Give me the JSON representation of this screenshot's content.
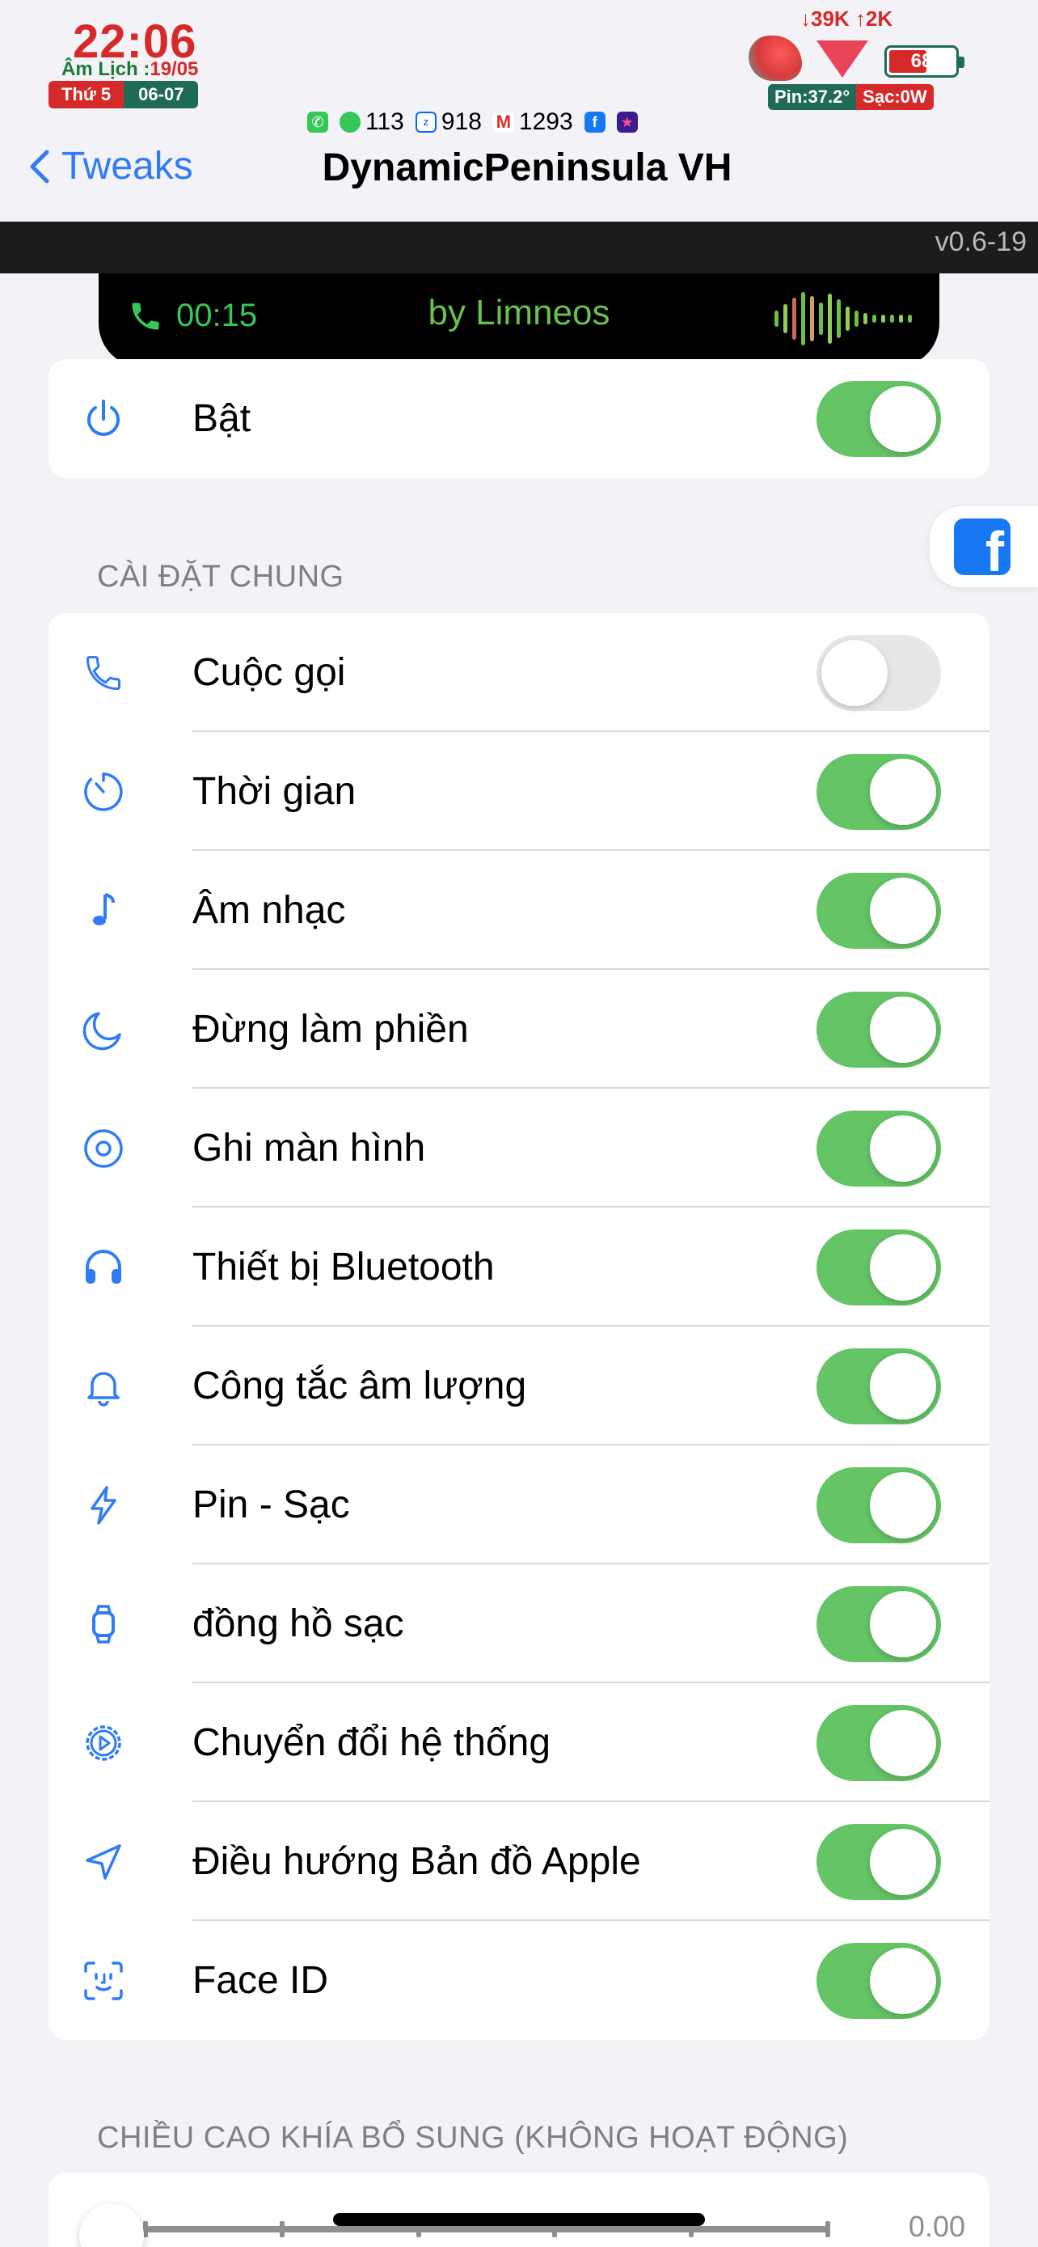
{
  "status_bar": {
    "time": "22:06",
    "lunar_prefix": "Âm Lịch :",
    "lunar_date": "19/05",
    "weekday": "Thứ 5",
    "date": "06-07",
    "net_speed": "↓39K ↑2K",
    "battery_level": "68",
    "battery_fraction": 0.62,
    "pin_temp": "Pin:37.2°",
    "charging": "Sạc:0W"
  },
  "notifications": [
    {
      "icon": "phone-icon",
      "count": ""
    },
    {
      "icon": "messages-icon",
      "count": "113"
    },
    {
      "icon": "zalo-icon",
      "count": "918"
    },
    {
      "icon": "gmail-icon",
      "count": "1293"
    },
    {
      "icon": "facebook-icon",
      "count": ""
    },
    {
      "icon": "app-icon",
      "count": ""
    }
  ],
  "nav": {
    "back_label": "Tweaks",
    "title": "DynamicPeninsula VH"
  },
  "preview": {
    "version": "v0.6-19",
    "call_time": "00:15",
    "byline": "by Limneos"
  },
  "enable_group": {
    "label": "Bật",
    "enabled": true,
    "icon": "power-icon"
  },
  "general_section": {
    "header": "CÀI ĐẶT CHUNG",
    "items": [
      {
        "label": "Cuộc gọi",
        "icon": "phone-icon",
        "on": false
      },
      {
        "label": "Thời gian",
        "icon": "timer-icon",
        "on": true
      },
      {
        "label": "Âm nhạc",
        "icon": "music-note-icon",
        "on": true
      },
      {
        "label": "Đừng làm phiền",
        "icon": "moon-icon",
        "on": true
      },
      {
        "label": "Ghi màn hình",
        "icon": "record-icon",
        "on": true
      },
      {
        "label": "Thiết bị Bluetooth",
        "icon": "headphones-icon",
        "on": true
      },
      {
        "label": "Công tắc âm lượng",
        "icon": "bell-icon",
        "on": true
      },
      {
        "label": "Pin - Sạc",
        "icon": "bolt-icon",
        "on": true
      },
      {
        "label": "đồng hồ sạc",
        "icon": "watch-icon",
        "on": true
      },
      {
        "label": "Chuyển đổi hệ thống",
        "icon": "gear-play-icon",
        "on": true
      },
      {
        "label": "Điều hướng Bản đồ Apple",
        "icon": "location-arrow-icon",
        "on": true
      },
      {
        "label": "Face ID",
        "icon": "face-id-icon",
        "on": true
      }
    ]
  },
  "height_section": {
    "header": "CHIỀU CAO KHÍA BỔ SUNG (KHÔNG HOẠT ĐỘNG)",
    "value_text": "0.00",
    "value_fraction": 0
  },
  "colors": {
    "accent": "#2f7cf6",
    "toggle_on": "#64c466",
    "toggle_off": "#e7e7ea"
  }
}
